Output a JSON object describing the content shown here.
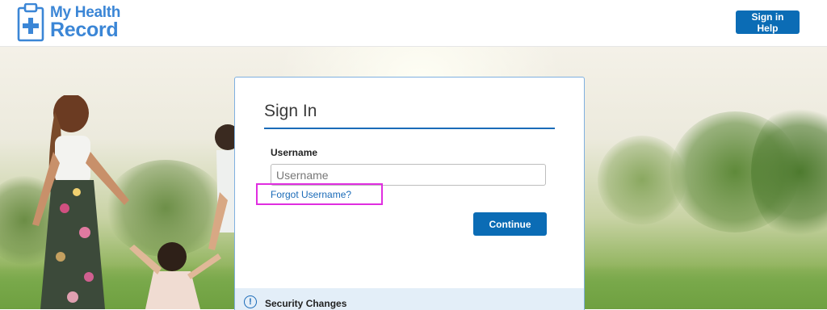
{
  "header": {
    "logo": {
      "line1": "My Health",
      "line2": "Record"
    },
    "help_button": "Sign in Help"
  },
  "signin": {
    "title": "Sign In",
    "username_label": "Username",
    "username_placeholder": "Username",
    "username_value": "",
    "forgot_username": "Forgot Username?",
    "continue_button": "Continue"
  },
  "notice": {
    "icon": "info-icon",
    "label": "Security Changes"
  },
  "colors": {
    "brand_blue": "#0b6cb5",
    "logo_blue": "#3b86d6",
    "highlight_magenta": "#e02ee0"
  }
}
